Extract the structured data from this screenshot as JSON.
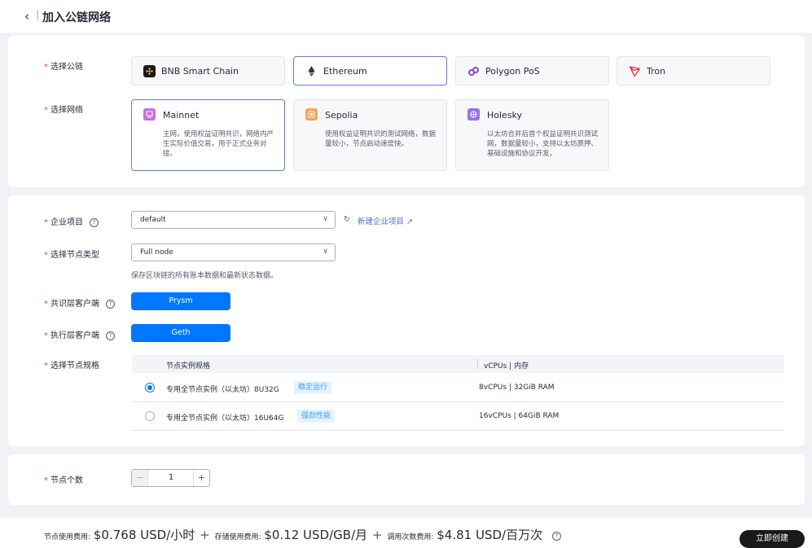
{
  "header": {
    "back_glyph": "‹",
    "separator": "|",
    "title": "加入公链网络"
  },
  "labels": {
    "chain": "选择公链",
    "network": "选择网络",
    "project": "企业项目",
    "node_type": "选择节点类型",
    "consensus": "共识层客户端",
    "execution": "执行层客户端",
    "spec": "选择节点规格",
    "count": "节点个数"
  },
  "chains": [
    {
      "name": "BNB Smart Chain",
      "icon": "bnb-icon",
      "selected": false
    },
    {
      "name": "Ethereum",
      "icon": "ethereum-icon",
      "selected": true
    },
    {
      "name": "Polygon PoS",
      "icon": "polygon-icon",
      "selected": false
    },
    {
      "name": "Tron",
      "icon": "tron-icon",
      "selected": false
    }
  ],
  "networks": [
    {
      "name": "Mainnet",
      "desc": "主网，使用权益证明共识，网络内产生实际价值交易，用于正式业务对接。",
      "color": "#c86ee0",
      "selected": true
    },
    {
      "name": "Sepolia",
      "desc": "使用权益证明共识的测试网络，数据量较小，节点启动速度快。",
      "color": "#f5a25d",
      "selected": false
    },
    {
      "name": "Holesky",
      "desc": "以太坊合并后首个权益证明共识测试网，数据量较小，支持以太坊质押、基础设施和协议开发。",
      "color": "#9c6ff0",
      "selected": false
    }
  ],
  "project": {
    "value": "default",
    "new_link": "新建企业项目"
  },
  "node_type": {
    "value": "Full node",
    "hint": "保存区块链的所有账本数据和最新状态数据。"
  },
  "consensus_client": "Prysm",
  "execution_client": "Geth",
  "spec_table": {
    "headers": [
      "节点实例规格",
      "vCPUs | 内存"
    ],
    "rows": [
      {
        "name": "专用全节点实例（以太坊）8U32G",
        "tag": "稳定运行",
        "spec": "8vCPUs | 32GiB RAM",
        "selected": true
      },
      {
        "name": "专用全节点实例（以太坊）16U64G",
        "tag": "强劲性能",
        "spec": "16vCPUs | 64GiB RAM",
        "selected": false
      }
    ]
  },
  "stepper": {
    "minus": "−",
    "value": "1",
    "plus": "+"
  },
  "footer": {
    "node_label": "节点使用费用:",
    "node_price": "$0.768 USD/小时",
    "storage_label": "存储使用费用:",
    "storage_price": "$0.12 USD/GB/月",
    "call_label": "调用次数费用:",
    "call_price": "$4.81 USD/百万次",
    "plus": "+",
    "create_button": "立即创建"
  },
  "colors": {
    "primary": "#0077ff",
    "link": "#526ecc",
    "required": "#e5413a",
    "selected_border": "#5e7ce0"
  }
}
